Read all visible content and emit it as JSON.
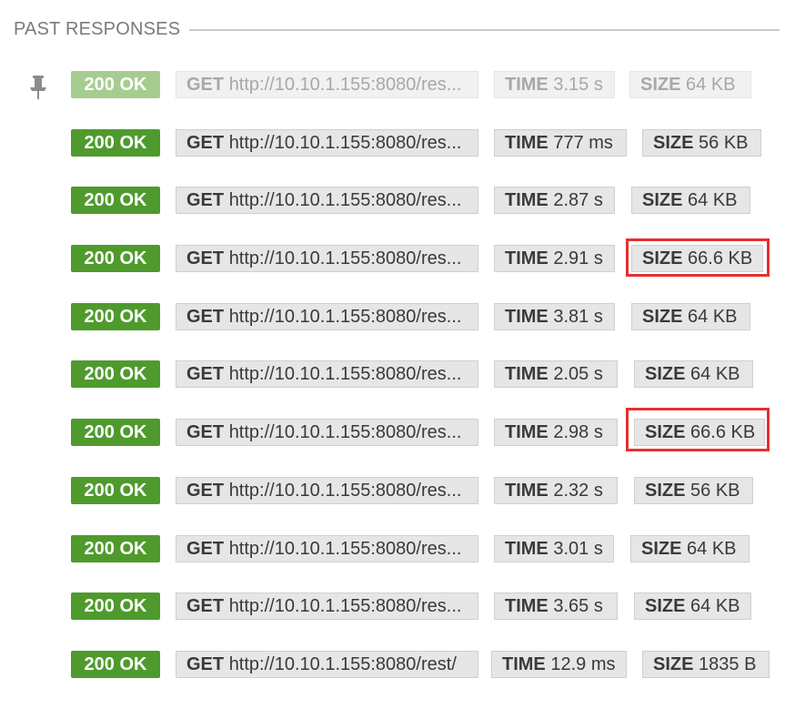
{
  "header": {
    "title": "PAST RESPONSES"
  },
  "pin_icon": "pushpin-icon",
  "colors": {
    "status_ok": "#4f9a2d",
    "status_ok_faded": "#a6cc90",
    "highlight": "#e5302d"
  },
  "responses": [
    {
      "status": "200 OK",
      "method": "GET",
      "url": "http://10.10.1.155:8080/res...",
      "time_label": "TIME",
      "time": "3.15 s",
      "size_label": "SIZE",
      "size": "64 KB"
    },
    {
      "status": "200 OK",
      "method": "GET",
      "url": "http://10.10.1.155:8080/res...",
      "time_label": "TIME",
      "time": "777 ms",
      "size_label": "SIZE",
      "size": "56 KB"
    },
    {
      "status": "200 OK",
      "method": "GET",
      "url": "http://10.10.1.155:8080/res...",
      "time_label": "TIME",
      "time": "2.87 s",
      "size_label": "SIZE",
      "size": "64 KB"
    },
    {
      "status": "200 OK",
      "method": "GET",
      "url": "http://10.10.1.155:8080/res...",
      "time_label": "TIME",
      "time": "2.91 s",
      "size_label": "SIZE",
      "size": "66.6 KB"
    },
    {
      "status": "200 OK",
      "method": "GET",
      "url": "http://10.10.1.155:8080/res...",
      "time_label": "TIME",
      "time": "3.81 s",
      "size_label": "SIZE",
      "size": "64 KB"
    },
    {
      "status": "200 OK",
      "method": "GET",
      "url": "http://10.10.1.155:8080/res...",
      "time_label": "TIME",
      "time": "2.05 s",
      "size_label": "SIZE",
      "size": "64 KB"
    },
    {
      "status": "200 OK",
      "method": "GET",
      "url": "http://10.10.1.155:8080/res...",
      "time_label": "TIME",
      "time": "2.98 s",
      "size_label": "SIZE",
      "size": "66.6 KB"
    },
    {
      "status": "200 OK",
      "method": "GET",
      "url": "http://10.10.1.155:8080/res...",
      "time_label": "TIME",
      "time": "2.32 s",
      "size_label": "SIZE",
      "size": "56 KB"
    },
    {
      "status": "200 OK",
      "method": "GET",
      "url": "http://10.10.1.155:8080/res...",
      "time_label": "TIME",
      "time": "3.01 s",
      "size_label": "SIZE",
      "size": "64 KB"
    },
    {
      "status": "200 OK",
      "method": "GET",
      "url": "http://10.10.1.155:8080/res...",
      "time_label": "TIME",
      "time": "3.65 s",
      "size_label": "SIZE",
      "size": "64 KB"
    },
    {
      "status": "200 OK",
      "method": "GET",
      "url": "http://10.10.1.155:8080/rest/",
      "time_label": "TIME",
      "time": "12.9 ms",
      "size_label": "SIZE",
      "size": "1835 B"
    }
  ]
}
